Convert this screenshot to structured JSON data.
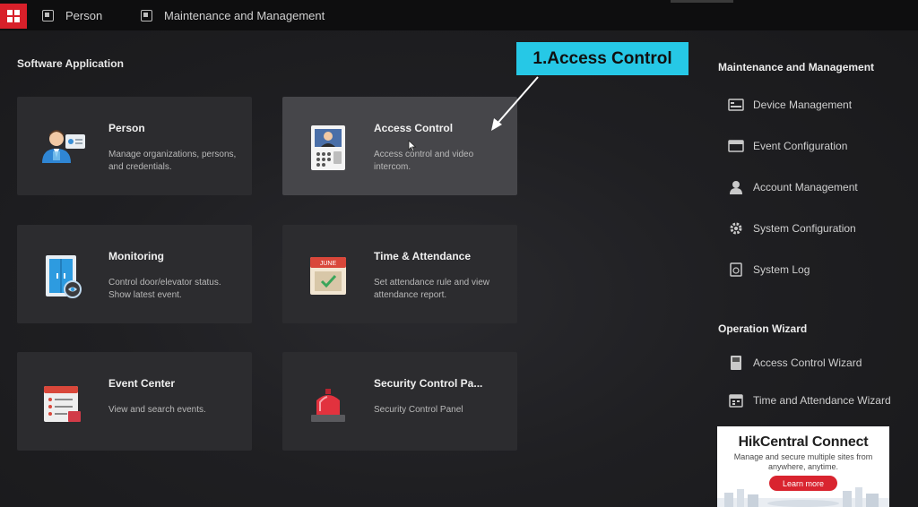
{
  "topbar": {
    "home_icon": "grid-icon",
    "tabs": [
      {
        "label": "Person",
        "icon": "person-doc-icon"
      },
      {
        "label": "Maintenance and Management",
        "icon": "maintenance-doc-icon"
      }
    ]
  },
  "software": {
    "title": "Software Application",
    "cards": [
      {
        "title": "Person",
        "desc": "Manage organizations, persons, and credentials.",
        "icon": "person-card-icon"
      },
      {
        "title": "Access Control",
        "desc": "Access control and video intercom.",
        "icon": "door-station-icon"
      },
      {
        "title": "Monitoring",
        "desc": "Control door/elevator status. Show latest event.",
        "icon": "door-monitor-icon"
      },
      {
        "title": "Time & Attendance",
        "desc": "Set attendance rule and view attendance report.",
        "icon": "calendar-icon",
        "calendar_month": "JUNE"
      },
      {
        "title": "Event Center",
        "desc": "View and search events.",
        "icon": "event-list-icon"
      },
      {
        "title": "Security Control Pa...",
        "desc": "Security Control Panel",
        "icon": "alarm-light-icon"
      }
    ]
  },
  "right_panel": {
    "maintenance": {
      "title": "Maintenance and Management",
      "items": [
        {
          "label": "Device Management",
          "icon": "device-icon"
        },
        {
          "label": "Event Configuration",
          "icon": "event-config-icon"
        },
        {
          "label": "Account Management",
          "icon": "account-icon"
        },
        {
          "label": "System Configuration",
          "icon": "gear-icon"
        },
        {
          "label": "System Log",
          "icon": "log-icon"
        }
      ]
    },
    "wizard": {
      "title": "Operation Wizard",
      "items": [
        {
          "label": "Access Control Wizard",
          "icon": "access-wizard-icon"
        },
        {
          "label": "Time and Attendance Wizard",
          "icon": "attendance-wizard-icon"
        }
      ]
    }
  },
  "annotation": {
    "label": "1.Access Control",
    "color": "#26c8e6"
  },
  "ad": {
    "title": "HikCentral Connect",
    "subtitle": "Manage and secure multiple sites from anywhere, anytime.",
    "button": "Learn more"
  },
  "colors": {
    "accent_red": "#d8202a",
    "card_bg": "#2c2c2f",
    "card_active_bg": "#46464a"
  }
}
